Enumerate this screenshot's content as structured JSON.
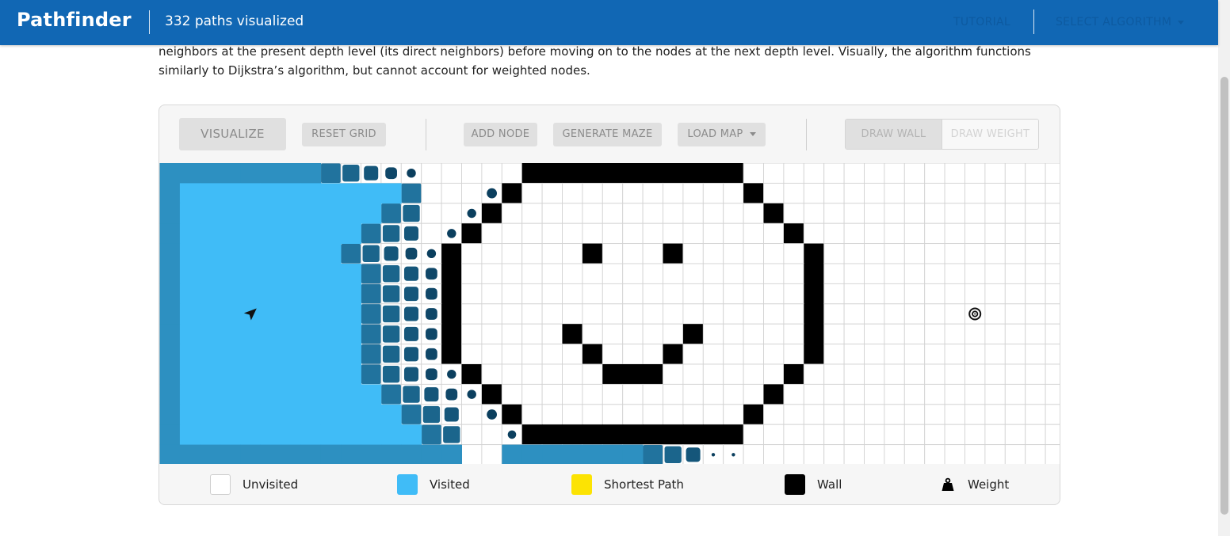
{
  "header": {
    "brand": "Pathfinder",
    "counter": "332 paths visualized",
    "tutorial": "TUTORIAL",
    "select_algorithm": "SELECT ALGORITHM"
  },
  "description": "neighbors at the present depth level (its direct neighbors) before moving on to the nodes at the next depth level. Visually, the algorithm functions similarly to Dijkstra’s algorithm, but cannot account for weighted nodes.",
  "toolbar": {
    "visualize": "VISUALIZE",
    "reset_grid": "RESET GRID",
    "add_node": "ADD NODE",
    "generate_maze": "GENERATE MAZE",
    "load_map": "LOAD MAP",
    "draw_wall": "DRAW WALL",
    "draw_weight": "DRAW WEIGHT"
  },
  "grid": {
    "rows": 15,
    "cols": 45,
    "start": [
      7,
      4
    ],
    "target": [
      7,
      40
    ],
    "walls": [
      [
        0,
        18
      ],
      [
        0,
        19
      ],
      [
        0,
        20
      ],
      [
        0,
        21
      ],
      [
        0,
        22
      ],
      [
        0,
        23
      ],
      [
        0,
        24
      ],
      [
        0,
        25
      ],
      [
        0,
        26
      ],
      [
        0,
        27
      ],
      [
        0,
        28
      ],
      [
        1,
        17
      ],
      [
        1,
        29
      ],
      [
        2,
        16
      ],
      [
        2,
        30
      ],
      [
        3,
        15
      ],
      [
        3,
        31
      ],
      [
        4,
        14
      ],
      [
        4,
        21
      ],
      [
        4,
        25
      ],
      [
        4,
        32
      ],
      [
        5,
        14
      ],
      [
        5,
        32
      ],
      [
        6,
        14
      ],
      [
        6,
        32
      ],
      [
        7,
        14
      ],
      [
        7,
        32
      ],
      [
        8,
        14
      ],
      [
        8,
        20
      ],
      [
        8,
        26
      ],
      [
        8,
        32
      ],
      [
        9,
        14
      ],
      [
        9,
        21
      ],
      [
        9,
        25
      ],
      [
        9,
        32
      ],
      [
        10,
        15
      ],
      [
        10,
        22
      ],
      [
        10,
        23
      ],
      [
        10,
        24
      ],
      [
        10,
        31
      ],
      [
        11,
        16
      ],
      [
        11,
        30
      ],
      [
        12,
        17
      ],
      [
        12,
        29
      ],
      [
        13,
        18
      ],
      [
        13,
        19
      ],
      [
        13,
        20
      ],
      [
        13,
        21
      ],
      [
        13,
        22
      ],
      [
        13,
        23
      ],
      [
        13,
        24
      ],
      [
        13,
        25
      ],
      [
        13,
        26
      ],
      [
        13,
        27
      ],
      [
        13,
        28
      ]
    ],
    "visited_extent": [
      12,
      12,
      12,
      12,
      13,
      14,
      14,
      14,
      14,
      14,
      14,
      14,
      14,
      14,
      14
    ],
    "visited_extra": [
      [
        1,
        16
      ],
      [
        2,
        15
      ],
      [
        3,
        14
      ],
      [
        11,
        15
      ],
      [
        12,
        16
      ],
      [
        13,
        17
      ],
      [
        14,
        17
      ],
      [
        14,
        18
      ],
      [
        14,
        19
      ],
      [
        14,
        20
      ],
      [
        14,
        21
      ],
      [
        14,
        22
      ],
      [
        14,
        23
      ],
      [
        14,
        24
      ],
      [
        14,
        25
      ],
      [
        14,
        26
      ],
      [
        14,
        27
      ],
      [
        14,
        28
      ]
    ]
  },
  "legend": {
    "unvisited": "Unvisited",
    "visited": "Visited",
    "shortest_path": "Shortest Path",
    "wall": "Wall",
    "weight": "Weight"
  },
  "colors": {
    "navbar": "#1167b4",
    "visited": "#40bcf7",
    "visited_dark": "#0b3f5e",
    "wall": "#000000",
    "shortest_path": "#fce303",
    "grid_line": "#d3d3d3"
  },
  "icons": {
    "start": "location-arrow-icon",
    "target": "target-bullseye-icon",
    "weight": "weight-icon"
  }
}
